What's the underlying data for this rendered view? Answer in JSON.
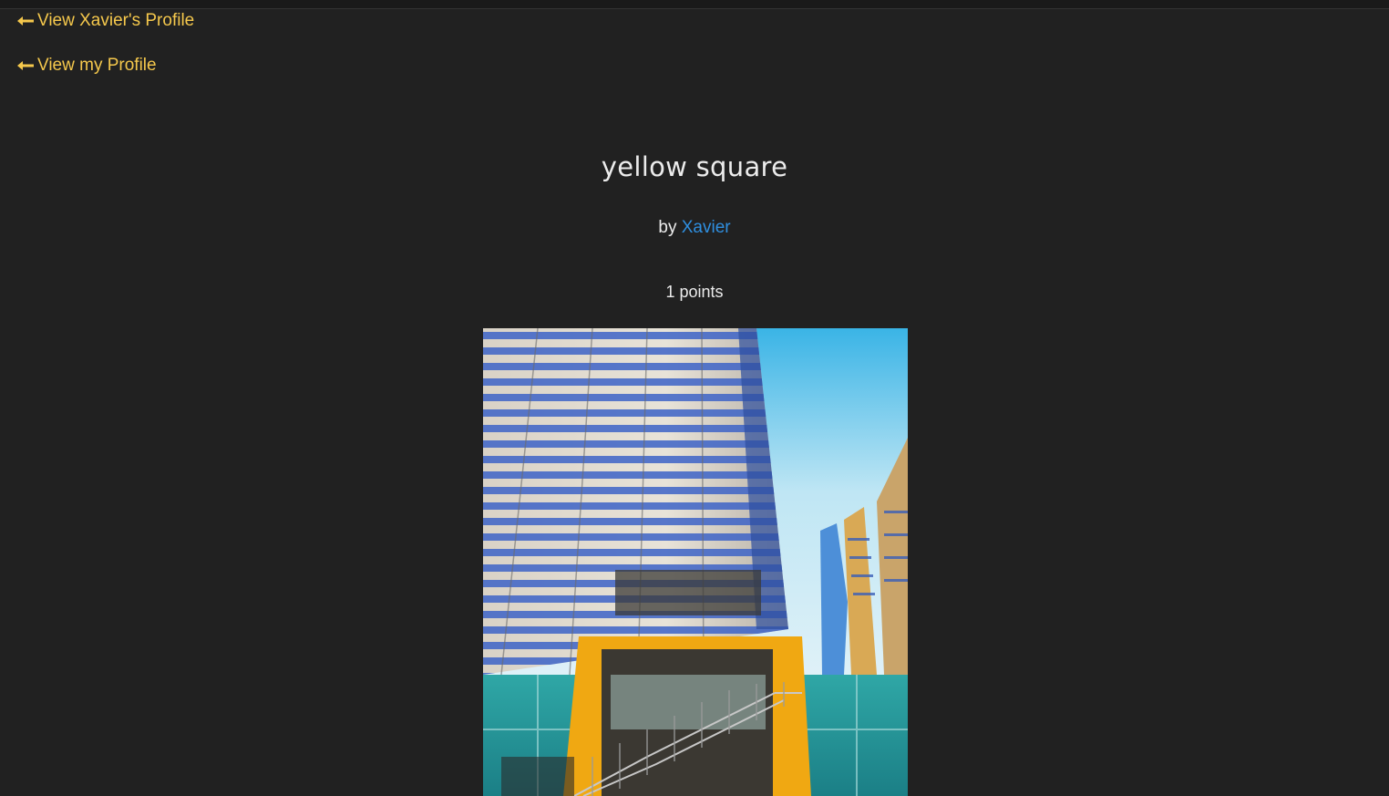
{
  "nav": {
    "back_links": [
      {
        "label": "View Xavier's Profile",
        "icon": "arrow-left-icon"
      },
      {
        "label": "View my Profile",
        "icon": "arrow-left-icon"
      }
    ]
  },
  "post": {
    "title": "yellow square",
    "by_prefix": "by",
    "author": "Xavier",
    "points_text": "1 points",
    "image_subject": "glass office tower with yellow-framed entrance and staircase"
  },
  "colors": {
    "background": "#212121",
    "link_yellow": "#f5c84c",
    "author_blue": "#2f8fe0",
    "text": "#ececec"
  }
}
